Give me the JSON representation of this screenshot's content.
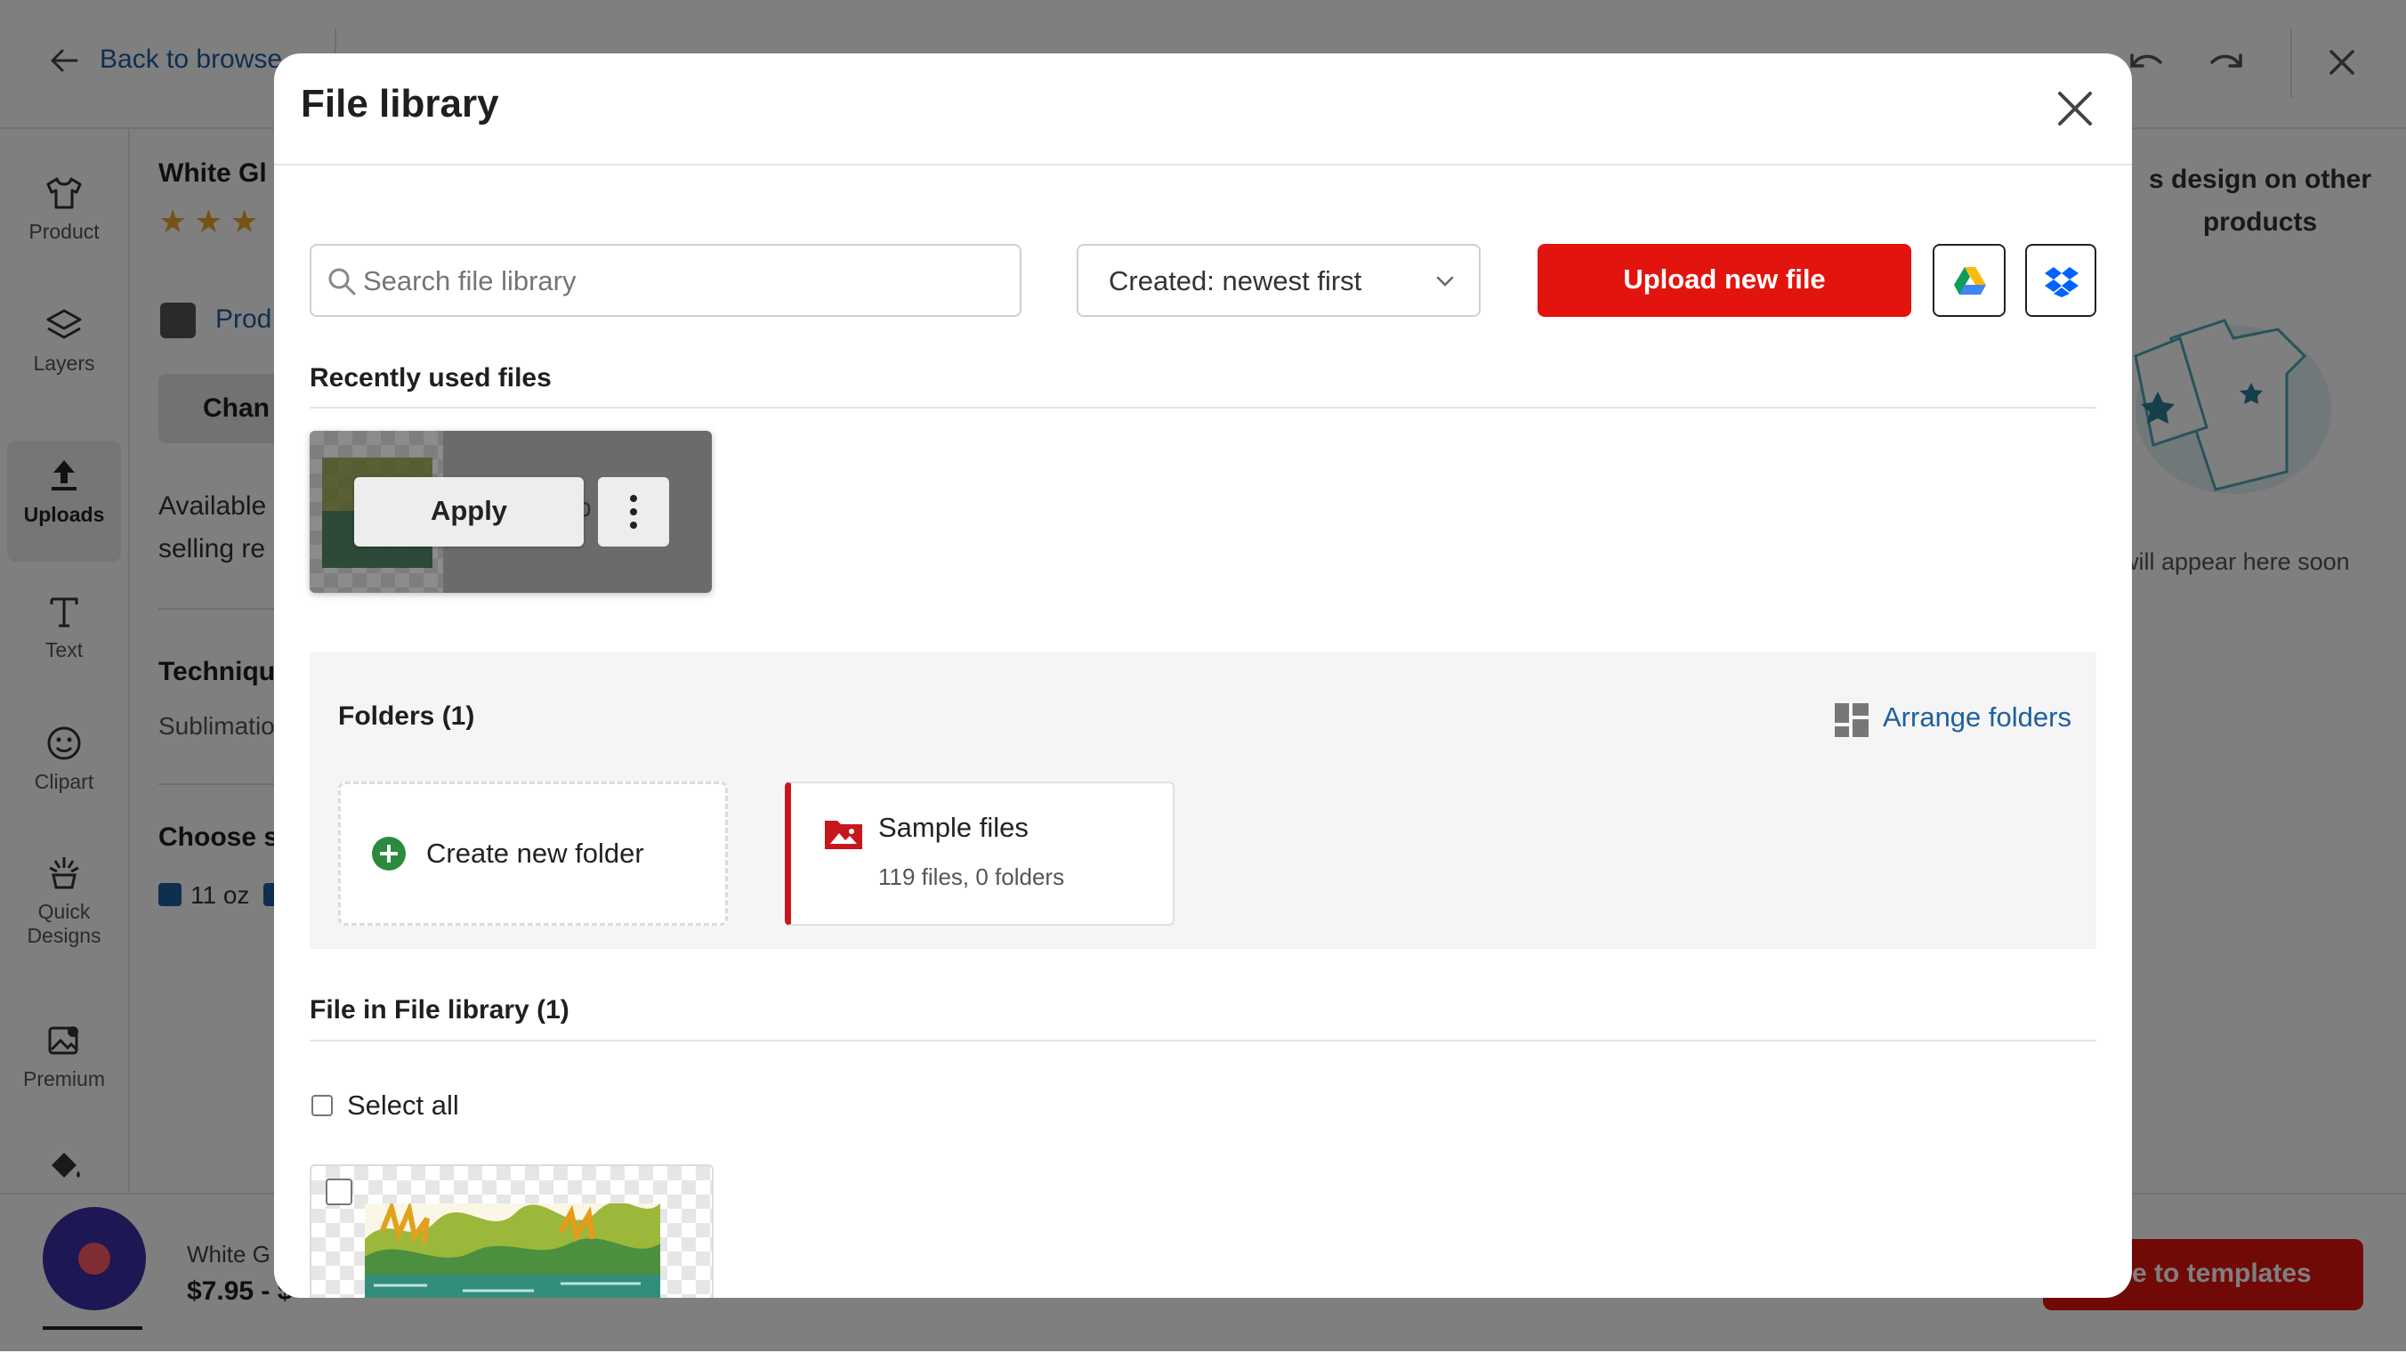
{
  "header": {
    "back_label": "Back to browse",
    "close_icon": "close-icon",
    "undo_icon": "undo-icon",
    "redo_icon": "redo-icon"
  },
  "sidebar": {
    "items": [
      {
        "label": "Product",
        "icon": "tshirt-icon"
      },
      {
        "label": "Layers",
        "icon": "layers-icon"
      },
      {
        "label": "Uploads",
        "icon": "upload-icon"
      },
      {
        "label": "Text",
        "icon": "text-icon"
      },
      {
        "label": "Clipart",
        "icon": "smiley-icon"
      },
      {
        "label": "Quick Designs",
        "icon": "sparkle-icon"
      },
      {
        "label": "Premium",
        "icon": "premium-image-icon"
      },
      {
        "label": "",
        "icon": "paint-bucket-icon"
      }
    ]
  },
  "background_panel": {
    "product_title": "White Gl",
    "product_link": "Prod",
    "change_button": "Chan",
    "available_line1": "Available",
    "available_line2": "selling re",
    "technique_heading": "Techniqu",
    "technique_value": "Sublimatio",
    "choose_heading": "Choose s",
    "size_option": "11 oz"
  },
  "right_panel": {
    "heading_line1": "s design on other",
    "heading_line2": "products",
    "note": "will appear here soon"
  },
  "bottom_bar": {
    "product_name": "White G",
    "price": "$7.95 - $",
    "templates_button": "e to templates"
  },
  "modal": {
    "title": "File library",
    "search": {
      "placeholder": "Search file library"
    },
    "sort": {
      "selected": "Created: newest first"
    },
    "upload_button": "Upload new file",
    "recent": {
      "heading": "Recently used files",
      "apply_button": "Apply",
      "partial_filename": "p"
    },
    "folders": {
      "heading": "Folders (1)",
      "arrange_label": "Arrange folders",
      "create_label": "Create new folder",
      "items": [
        {
          "name": "Sample files",
          "meta": "119 files, 0 folders"
        }
      ]
    },
    "files": {
      "heading": "File in File library (1)",
      "select_all": "Select all"
    }
  },
  "colors": {
    "brand_red": "#e3140e",
    "link_blue": "#1e5fa0",
    "green": "#2b8a3e",
    "chat_purple": "#3b2fa8"
  }
}
